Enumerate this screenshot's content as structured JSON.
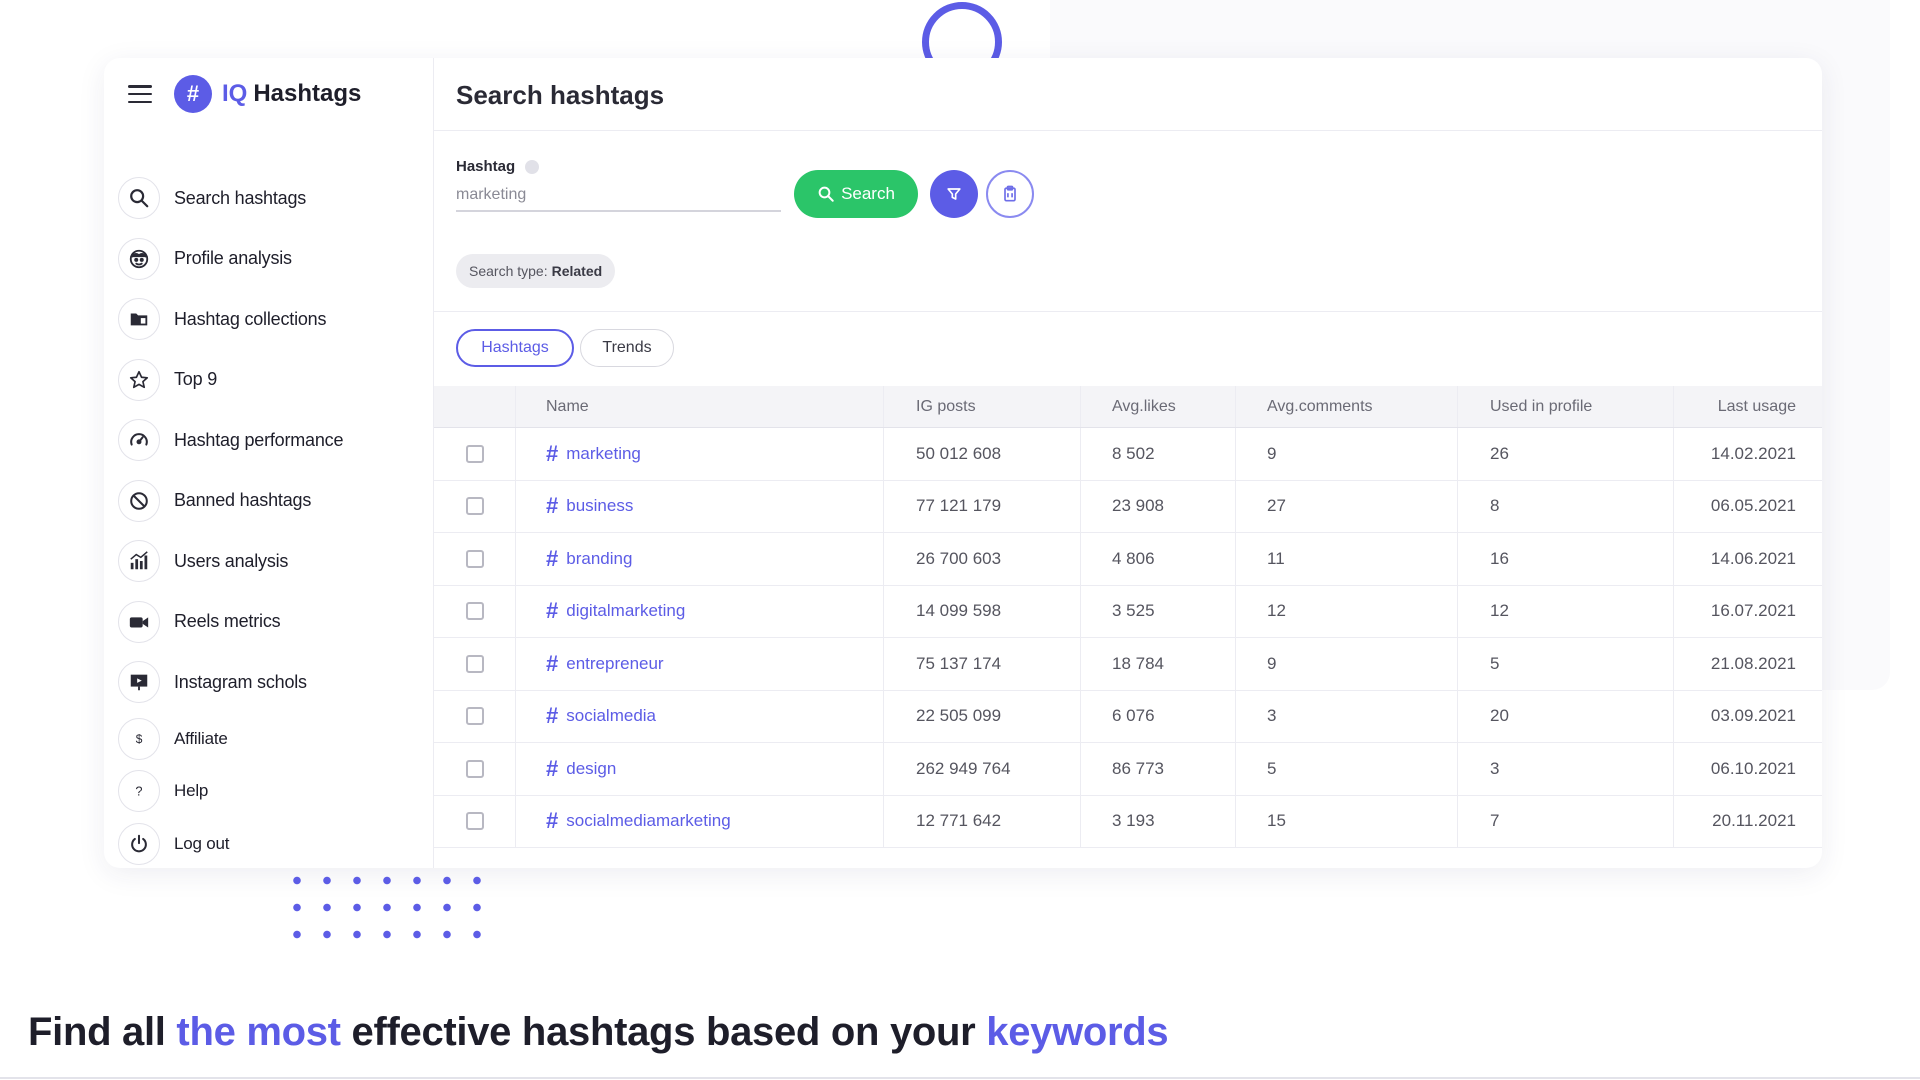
{
  "brand": {
    "prefix": "IQ",
    "name": "Hashtags",
    "logo_glyph": "#"
  },
  "sidebar": {
    "items": [
      {
        "label": "Search hashtags",
        "icon": "search-icon"
      },
      {
        "label": "Profile analysis",
        "icon": "profile-face-icon"
      },
      {
        "label": "Hashtag collections",
        "icon": "folder-icon"
      },
      {
        "label": "Top 9",
        "icon": "star-icon"
      },
      {
        "label": "Hashtag performance",
        "icon": "speedometer-icon"
      },
      {
        "label": "Banned hashtags",
        "icon": "ban-icon"
      },
      {
        "label": "Users analysis",
        "icon": "bar-chart-icon"
      },
      {
        "label": "Reels metrics",
        "icon": "video-camera-icon"
      },
      {
        "label": "Instagram schols",
        "icon": "presentation-icon"
      }
    ],
    "footer": [
      {
        "label": "Affiliate",
        "icon": "dollar-icon"
      },
      {
        "label": "Help",
        "icon": "help-icon"
      },
      {
        "label": "Log out",
        "icon": "power-icon"
      }
    ]
  },
  "main": {
    "title": "Search hashtags",
    "field_label": "Hashtag",
    "field_value": "marketing",
    "search_label": "Search",
    "chip_prefix": "Search type:",
    "chip_value": "Related",
    "tabs": [
      "Hashtags",
      "Trends"
    ]
  },
  "table": {
    "columns": [
      "Name",
      "IG posts",
      "Avg.likes",
      "Avg.comments",
      "Used in profile",
      "Last usage"
    ],
    "rows": [
      {
        "name": "marketing",
        "posts": "50 012 608",
        "likes": "8 502",
        "comments": "9",
        "used": "26",
        "last": "14.02.2021"
      },
      {
        "name": "business",
        "posts": "77 121 179",
        "likes": "23 908",
        "comments": "27",
        "used": "8",
        "last": "06.05.2021"
      },
      {
        "name": "branding",
        "posts": "26 700 603",
        "likes": "4 806",
        "comments": "11",
        "used": "16",
        "last": "14.06.2021"
      },
      {
        "name": "digitalmarketing",
        "posts": "14 099 598",
        "likes": "3 525",
        "comments": "12",
        "used": "12",
        "last": "16.07.2021"
      },
      {
        "name": "entrepreneur",
        "posts": "75 137 174",
        "likes": "18 784",
        "comments": "9",
        "used": "5",
        "last": "21.08.2021"
      },
      {
        "name": "socialmedia",
        "posts": "22 505 099",
        "likes": "6 076",
        "comments": "3",
        "used": "20",
        "last": "03.09.2021"
      },
      {
        "name": "design",
        "posts": "262 949 764",
        "likes": "86 773",
        "comments": "5",
        "used": "3",
        "last": "06.10.2021"
      },
      {
        "name": "socialmediamarketing",
        "posts": "12 771 642",
        "likes": "3 193",
        "comments": "15",
        "used": "7",
        "last": "20.11.2021"
      }
    ]
  },
  "headline": {
    "part1": "Find all ",
    "accent1": "the most",
    "part2": " effective hashtags based on your ",
    "accent2": "keywords"
  },
  "colors": {
    "accent": "#5c5ce6",
    "green": "#2bc569",
    "yellow": "#f7c54a"
  }
}
